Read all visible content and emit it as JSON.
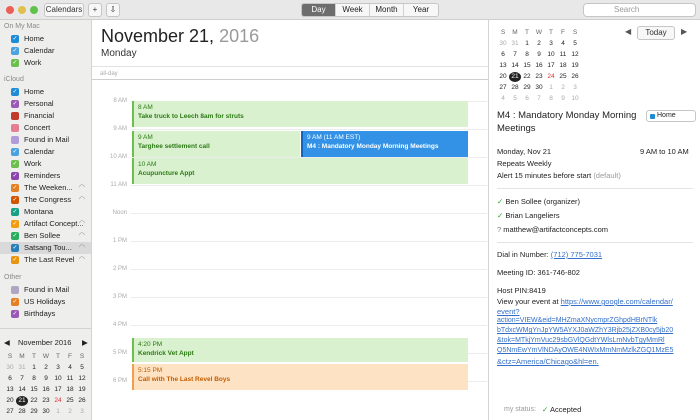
{
  "toolbar": {
    "calendars_label": "Calendars",
    "add_label": "+",
    "export_label": "⇩",
    "views": [
      "Day",
      "Week",
      "Month",
      "Year"
    ],
    "active_view": "Day",
    "search_placeholder": "Search"
  },
  "sidebar": {
    "on_my_mac": "On My Mac",
    "mac_items": [
      {
        "label": "Home",
        "color": "#1e8bd6"
      },
      {
        "label": "Calendar",
        "color": "#4aa3df"
      },
      {
        "label": "Work",
        "color": "#6cbf4f"
      }
    ],
    "icloud": "iCloud",
    "icloud_items": [
      {
        "label": "Home",
        "color": "#1e8bd6",
        "checked": true
      },
      {
        "label": "Personal",
        "color": "#9b59b6",
        "checked": true
      },
      {
        "label": "Financial",
        "color": "#c0392b",
        "checked": false
      },
      {
        "label": "Concert",
        "color": "#e67e93",
        "checked": false
      },
      {
        "label": "Found in Mail",
        "color": "#b19cd9",
        "checked": false
      },
      {
        "label": "Calendar",
        "color": "#4aa3df",
        "checked": true
      },
      {
        "label": "Work",
        "color": "#6cbf4f",
        "checked": true
      },
      {
        "label": "Reminders",
        "color": "#8e44ad",
        "checked": true
      },
      {
        "label": "The Weeken...",
        "color": "#e67e22",
        "checked": true,
        "shared": true
      },
      {
        "label": "The Congress",
        "color": "#d35400",
        "checked": true,
        "shared": true
      },
      {
        "label": "Montana",
        "color": "#16a085",
        "checked": true
      },
      {
        "label": "Artifact Concept...",
        "color": "#f39c12",
        "checked": true,
        "shared": true
      },
      {
        "label": "Ben Sollee",
        "color": "#27ae60",
        "checked": true,
        "shared": true
      },
      {
        "label": "Satsang Tou...",
        "color": "#2980b9",
        "checked": true,
        "shared": true
      },
      {
        "label": "The Last Revel",
        "color": "#e8940d",
        "checked": true,
        "shared": true
      }
    ],
    "other": "Other",
    "other_items": [
      {
        "label": "Found in Mail",
        "color": "#b0a6c4",
        "checked": false
      },
      {
        "label": "US Holidays",
        "color": "#e67e22",
        "checked": true
      },
      {
        "label": "Birthdays",
        "color": "#9b59b6",
        "checked": true
      }
    ]
  },
  "mini_calendar": {
    "month_label": "November 2016",
    "weekday_headers": [
      "S",
      "M",
      "T",
      "W",
      "T",
      "F",
      "S"
    ],
    "weeks": [
      [
        "30",
        "31",
        "1",
        "2",
        "3",
        "4",
        "5"
      ],
      [
        "6",
        "7",
        "8",
        "9",
        "10",
        "11",
        "12"
      ],
      [
        "13",
        "14",
        "15",
        "16",
        "17",
        "18",
        "19"
      ],
      [
        "20",
        "21",
        "22",
        "23",
        "24",
        "25",
        "26"
      ],
      [
        "27",
        "28",
        "29",
        "30",
        "1",
        "2",
        "3"
      ]
    ]
  },
  "main": {
    "date_text": "November 21,",
    "year_text": "2016",
    "weekday": "Monday",
    "allday_label": "all-day",
    "hours": [
      "8 AM",
      "9 AM",
      "10 AM",
      "11 AM",
      "Noon",
      "1 PM",
      "2 PM",
      "3 PM",
      "4 PM",
      "5 PM",
      "6 PM"
    ],
    "events": [
      {
        "time": "8 AM",
        "title": "Take truck to Leech 8am for struts",
        "style": "green"
      },
      {
        "time": "9 AM",
        "title": "Targhee settlement call",
        "style": "green"
      },
      {
        "time": "9 AM (11 AM EST)",
        "title": "M4 : Mandatory Monday Morning Meetings",
        "style": "blue"
      },
      {
        "time": "10 AM",
        "title": "Acupuncture Appt",
        "style": "green"
      },
      {
        "time": "4:20 PM",
        "title": "Kendrick Vet Appt",
        "style": "green"
      },
      {
        "time": "5:15 PM",
        "title": "Call with The Last Revel Boys",
        "style": "orange"
      }
    ]
  },
  "right_calendar": {
    "today_label": "Today",
    "weekday_headers": [
      "S",
      "M",
      "T",
      "W",
      "T",
      "F",
      "S"
    ],
    "weeks": [
      [
        "30",
        "31",
        "1",
        "2",
        "3",
        "4",
        "5"
      ],
      [
        "6",
        "7",
        "8",
        "9",
        "10",
        "11",
        "12"
      ],
      [
        "13",
        "14",
        "15",
        "16",
        "17",
        "18",
        "19"
      ],
      [
        "20",
        "21",
        "22",
        "23",
        "24",
        "25",
        "26"
      ],
      [
        "27",
        "28",
        "29",
        "30",
        "1",
        "2",
        "3"
      ],
      [
        "4",
        "5",
        "6",
        "7",
        "8",
        "9",
        "10"
      ]
    ]
  },
  "detail": {
    "title_line1": "M4 : Mandatory Monday Morning",
    "title_line2": "Meetings",
    "calendar_name": "Home",
    "date": "Monday, Nov 21",
    "time": "9 AM to 10 AM",
    "repeats": "Repeats Weekly",
    "alert": "Alert 15 minutes before start",
    "alert_suffix": "(default)",
    "attendees": [
      "Ben Sollee (organizer)",
      "Brian Langeliers",
      "matthew@artifactconcepts.com"
    ],
    "dial_label": "Dial in Number:",
    "dial_number": "(712) 775-7031",
    "meeting_id": "Meeting ID: 361-746-802",
    "host_pin": "Host PIN:8419",
    "view_text": "View your event at",
    "url_lines": [
      "https://www.google.com/calendar/",
      "event?",
      "action=VIEW&eid=MHZmaXNycmprZGhpdHBrNTlk",
      "bTdxcWMgYnJpYW5AYXJ0aWZhY3Rjb25jZXB0cy5jb20",
      "&tok=MTkjYmVuc29sbGVlQGdtYWlsLmNvbTgyMmRl",
      "Q5NmEwYmVlNDAyOWE4NWIxMmNmMzlkZGQ1MzE5",
      "&ctz=America/Chicago&hl=en."
    ],
    "status_label": "my status:",
    "status_value": "Accepted"
  }
}
